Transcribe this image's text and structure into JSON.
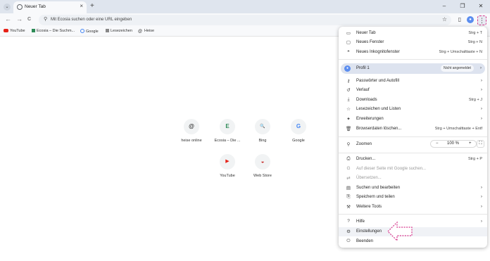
{
  "tab": {
    "title": "Neuer Tab",
    "close": "×"
  },
  "tabstrip": {
    "new_tab": "+",
    "minimize": "–",
    "restore": "❐",
    "close": "✕"
  },
  "toolbar": {
    "back": "←",
    "forward": "→",
    "reload": "C",
    "omnibox_placeholder": "Mit Ecosia suchen oder eine URL eingeben",
    "menu": "⋮"
  },
  "bookmarks": [
    "YouTube",
    "Ecosia – Die Suchm...",
    "Google",
    "Lesezeichen",
    "Heise"
  ],
  "shortcuts": [
    {
      "label": "heise online",
      "glyph": "@"
    },
    {
      "label": "Ecosia – Die ...",
      "glyph": "E"
    },
    {
      "label": "Bing",
      "glyph": "🔍"
    },
    {
      "label": "Google",
      "glyph": "G"
    },
    {
      "label": "YouTube",
      "glyph": "▶"
    },
    {
      "label": "Web Store",
      "glyph": "◒"
    }
  ],
  "menu": {
    "new_tab": {
      "label": "Neuer Tab",
      "shortcut": "Strg + T"
    },
    "new_window": {
      "label": "Neues Fenster",
      "shortcut": "Strg + N"
    },
    "incognito": {
      "label": "Neues Inkognitofenster",
      "shortcut": "Strg + Umschalttaste + N"
    },
    "profile": {
      "label": "Profil 1",
      "badge": "Nicht angemeldet"
    },
    "passwords": {
      "label": "Passwörter und Autofill"
    },
    "history": {
      "label": "Verlauf"
    },
    "downloads": {
      "label": "Downloads",
      "shortcut": "Strg + J"
    },
    "bookmarks": {
      "label": "Lesezeichen und Listen"
    },
    "extensions": {
      "label": "Erweiterungen"
    },
    "clear_data": {
      "label": "Browserdaten löschen...",
      "shortcut": "Strg + Umschalttaste + Entf"
    },
    "zoom": {
      "label": "Zoomen",
      "minus": "−",
      "value": "100 %",
      "plus": "+"
    },
    "print": {
      "label": "Drucken...",
      "shortcut": "Strg + P"
    },
    "search_google": {
      "label": "Auf dieser Seite mit Google suchen..."
    },
    "translate": {
      "label": "Übersetzen..."
    },
    "find_edit": {
      "label": "Suchen und bearbeiten"
    },
    "save_share": {
      "label": "Speichern und teilen"
    },
    "more_tools": {
      "label": "Weitere Tools"
    },
    "help": {
      "label": "Hilfe"
    },
    "settings": {
      "label": "Einstellungen"
    },
    "exit": {
      "label": "Beenden"
    }
  },
  "colors": {
    "annotation": "#d6378d",
    "accent": "#5b8def"
  }
}
